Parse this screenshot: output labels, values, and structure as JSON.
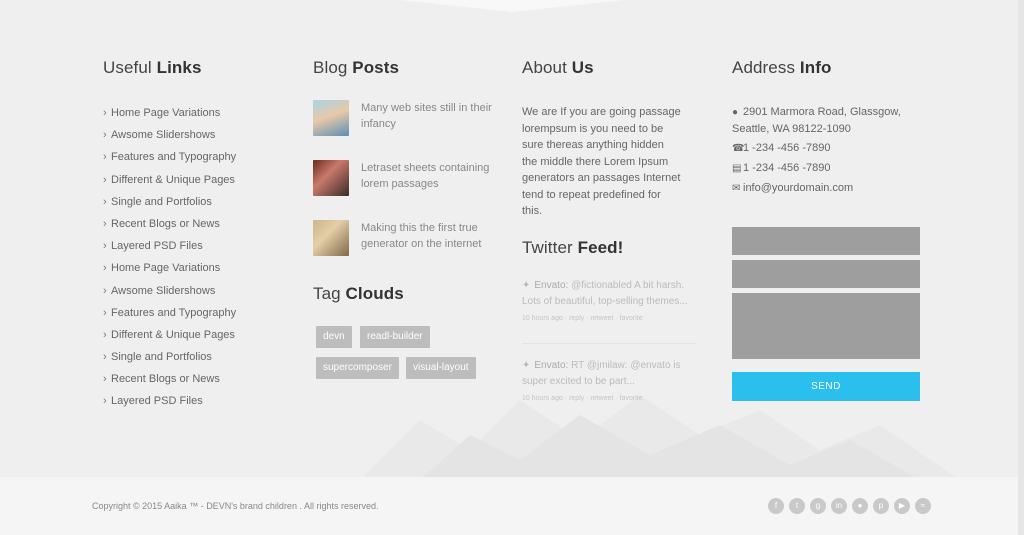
{
  "useful_links": {
    "title_light": "Useful ",
    "title_bold": "Links",
    "items": [
      "Home Page Variations",
      "Awsome Slidershows",
      "Features and Typography",
      "Different & Unique Pages",
      "Single and Portfolios",
      "Recent Blogs or News",
      "Layered PSD Files",
      "Home Page Variations",
      "Awsome Slidershows",
      "Features and Typography",
      "Different & Unique Pages",
      "Single and Portfolios",
      "Recent Blogs or News",
      "Layered PSD Files"
    ]
  },
  "blog_posts": {
    "title_light": "Blog ",
    "title_bold": "Posts",
    "posts": [
      {
        "text": "Many web sites still in their infancy"
      },
      {
        "text": "Letraset sheets containing lorem passages"
      },
      {
        "text": "Making this the first true generator on the internet"
      }
    ]
  },
  "tag_clouds": {
    "title_light": "Tag ",
    "title_bold": "Clouds",
    "tags": [
      "devn",
      "readl-builder",
      "supercomposer",
      "visual-layout"
    ]
  },
  "about": {
    "title_light": "About ",
    "title_bold": "Us",
    "text": "We are If you are going passage lorempsum is you need to be sure thereas anything hidden the middle there Lorem Ipsum generators an passages Internet tend to repeat predefined for this."
  },
  "twitter": {
    "title_light": "Twitter ",
    "title_bold": "Feed!",
    "tweets": [
      {
        "author": "Envato:",
        "text": "@fictionabled A bit harsh. Lots of beautiful, top-selling themes...",
        "meta": "10 hours ago · reply · retweet · favorite"
      },
      {
        "author": "Envato:",
        "text": "RT @jmilaw: @envato is super excited to be part...",
        "meta": "10 hours ago · reply · retweet · favorite"
      }
    ]
  },
  "address": {
    "title_light": "Address ",
    "title_bold": "Info",
    "street": "2901 Marmora Road, Glassgow,",
    "city": "Seattle, WA 98122-1090",
    "phone": "1 -234 -456 -7890",
    "fax": "1 -234 -456 -7890",
    "email": "info@yourdomain.com",
    "send_label": "SEND"
  },
  "footer": {
    "copyright": "Copyright © 2015 Aaika ™ - DEVN's brand children . All rights reserved.",
    "socials": [
      "facebook-icon",
      "twitter-icon",
      "google-plus-icon",
      "linkedin-icon",
      "flickr-icon",
      "pinterest-icon",
      "youtube-icon",
      "rss-icon"
    ]
  },
  "colors": {
    "background": "#efefef",
    "accent": "#2bbfee",
    "tag_bg": "#bdbdbd",
    "field_bg": "#9e9e9e"
  }
}
